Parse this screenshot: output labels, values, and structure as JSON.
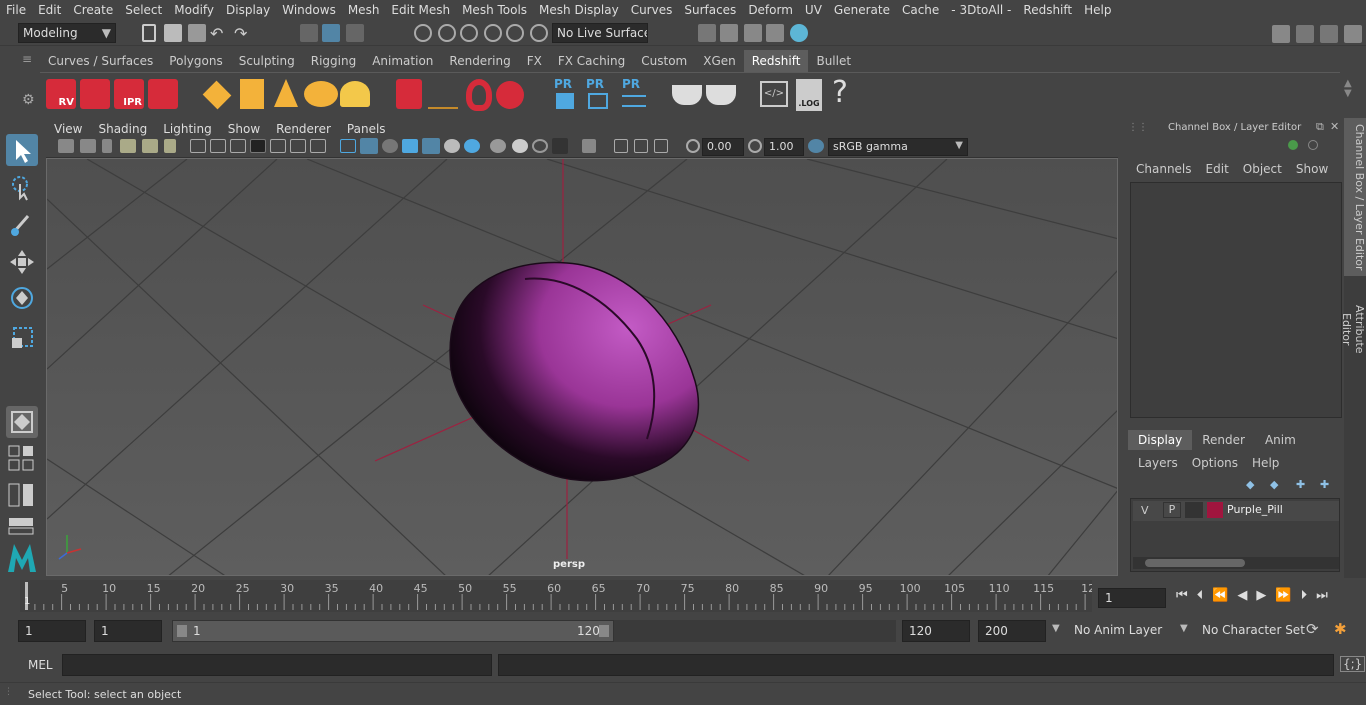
{
  "menus": [
    "File",
    "Edit",
    "Create",
    "Select",
    "Modify",
    "Display",
    "Windows",
    "Mesh",
    "Edit Mesh",
    "Mesh Tools",
    "Mesh Display",
    "Curves",
    "Surfaces",
    "Deform",
    "UV",
    "Generate",
    "Cache",
    "- 3DtoAll -",
    "Redshift",
    "Help"
  ],
  "status": {
    "workspace": "Modeling",
    "live_surface": "No Live Surface"
  },
  "shelf_tabs": [
    "Curves / Surfaces",
    "Polygons",
    "Sculpting",
    "Rigging",
    "Animation",
    "Rendering",
    "FX",
    "FX Caching",
    "Custom",
    "XGen",
    "Redshift",
    "Bullet"
  ],
  "active_shelf": "Redshift",
  "shelf_labels": {
    "rv": "RV",
    "ipr": "IPR",
    "pr": "PR",
    "log": ".LOG",
    "help": "?"
  },
  "viewport": {
    "menus": [
      "View",
      "Shading",
      "Lighting",
      "Show",
      "Renderer",
      "Panels"
    ],
    "exposure": "0.00",
    "gamma": "1.00",
    "color_space": "sRGB gamma",
    "camera_label": "persp"
  },
  "channel_box": {
    "title": "Channel Box / Layer Editor",
    "menus": [
      "Channels",
      "Edit",
      "Object",
      "Show"
    ]
  },
  "layer_editor": {
    "tabs": [
      "Display",
      "Render",
      "Anim"
    ],
    "active_tab": "Display",
    "menus": [
      "Layers",
      "Options",
      "Help"
    ],
    "layer": {
      "v": "V",
      "p": "P",
      "name": "Purple_Pill",
      "color": "#a0153e"
    }
  },
  "side_tabs": [
    "Channel Box / Layer Editor",
    "Attribute Editor"
  ],
  "timeline": {
    "ticks": [
      "5",
      "10",
      "15",
      "20",
      "25",
      "30",
      "35",
      "40",
      "45",
      "50",
      "55",
      "60",
      "65",
      "70",
      "75",
      "80",
      "85",
      "90",
      "95",
      "100",
      "105",
      "110",
      "115",
      "12"
    ],
    "start_label": "1",
    "current_frame": "1"
  },
  "range": {
    "start": "1",
    "anim_start": "1",
    "slider_start": "1",
    "slider_end": "120",
    "end": "120",
    "anim_end": "200",
    "anim_layer": "No Anim Layer",
    "character_set": "No Character Set"
  },
  "mel": {
    "label": "MEL"
  },
  "help_line": "Select Tool: select an object",
  "colors": {
    "accent": "#5285a6",
    "pill": "#b546b8",
    "red_cube": "#d62b3a"
  }
}
